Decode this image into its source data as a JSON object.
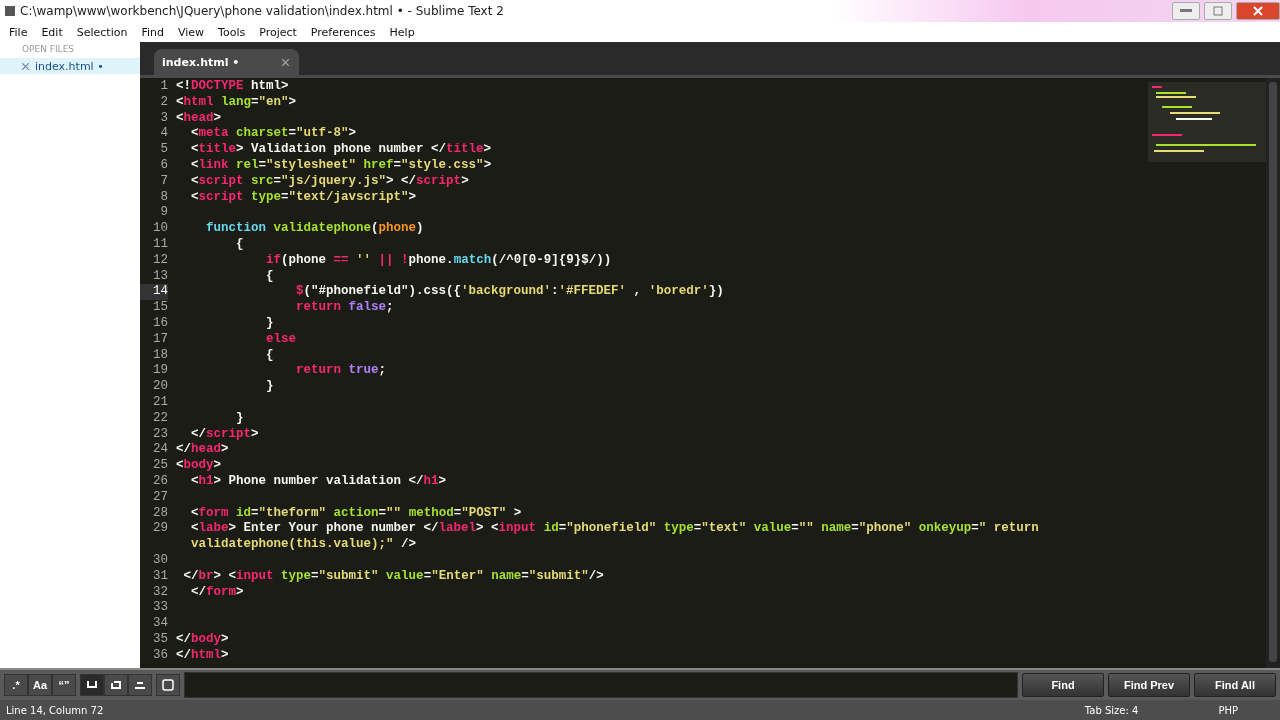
{
  "window": {
    "title": "C:\\wamp\\www\\workbench\\JQuery\\phone validation\\index.html • - Sublime Text 2"
  },
  "menu": [
    "File",
    "Edit",
    "Selection",
    "Find",
    "View",
    "Tools",
    "Project",
    "Preferences",
    "Help"
  ],
  "sidebar": {
    "header": "OPEN FILES",
    "files": [
      {
        "name": "index.html •",
        "selected": true
      }
    ]
  },
  "tabs": [
    {
      "label": "index.html •",
      "selected": true
    }
  ],
  "code": [
    {
      "number": "1",
      "current": false,
      "segments": [
        {
          "text": "<!",
          "kind": "plain"
        },
        {
          "text": "DOCTYPE",
          "kind": "tag"
        },
        {
          "text": " html>",
          "kind": "plain"
        }
      ]
    },
    {
      "number": "2",
      "current": false,
      "segments": [
        {
          "text": "<",
          "kind": "plain"
        },
        {
          "text": "html",
          "kind": "tag"
        },
        {
          "text": " lang",
          "kind": "attr"
        },
        {
          "text": "=",
          "kind": "plain"
        },
        {
          "text": "\"en\"",
          "kind": "str"
        },
        {
          "text": ">",
          "kind": "plain"
        }
      ]
    },
    {
      "number": "3",
      "current": false,
      "segments": [
        {
          "text": "<",
          "kind": "plain"
        },
        {
          "text": "head",
          "kind": "tag"
        },
        {
          "text": ">",
          "kind": "plain"
        }
      ]
    },
    {
      "number": "4",
      "current": false,
      "segments": [
        {
          "text": "  <",
          "kind": "plain"
        },
        {
          "text": "meta",
          "kind": "tag"
        },
        {
          "text": " charset",
          "kind": "attr"
        },
        {
          "text": "=",
          "kind": "plain"
        },
        {
          "text": "\"utf-8\"",
          "kind": "str"
        },
        {
          "text": ">",
          "kind": "plain"
        }
      ]
    },
    {
      "number": "5",
      "current": false,
      "segments": [
        {
          "text": "  <",
          "kind": "plain"
        },
        {
          "text": "title",
          "kind": "tag"
        },
        {
          "text": "> Validation phone number </",
          "kind": "plain"
        },
        {
          "text": "title",
          "kind": "tag"
        },
        {
          "text": ">",
          "kind": "plain"
        }
      ]
    },
    {
      "number": "6",
      "current": false,
      "segments": [
        {
          "text": "  <",
          "kind": "plain"
        },
        {
          "text": "link",
          "kind": "tag"
        },
        {
          "text": " rel",
          "kind": "attr"
        },
        {
          "text": "=",
          "kind": "plain"
        },
        {
          "text": "\"stylesheet\"",
          "kind": "str"
        },
        {
          "text": " href",
          "kind": "attr"
        },
        {
          "text": "=",
          "kind": "plain"
        },
        {
          "text": "\"style.css\"",
          "kind": "str"
        },
        {
          "text": ">",
          "kind": "plain"
        }
      ]
    },
    {
      "number": "7",
      "current": false,
      "segments": [
        {
          "text": "  <",
          "kind": "plain"
        },
        {
          "text": "script",
          "kind": "tag"
        },
        {
          "text": " src",
          "kind": "attr"
        },
        {
          "text": "=",
          "kind": "plain"
        },
        {
          "text": "\"js/jquery.js\"",
          "kind": "str"
        },
        {
          "text": "> </",
          "kind": "plain"
        },
        {
          "text": "script",
          "kind": "tag"
        },
        {
          "text": ">",
          "kind": "plain"
        }
      ]
    },
    {
      "number": "8",
      "current": false,
      "segments": [
        {
          "text": "  <",
          "kind": "plain"
        },
        {
          "text": "script",
          "kind": "tag"
        },
        {
          "text": " type",
          "kind": "attr"
        },
        {
          "text": "=",
          "kind": "plain"
        },
        {
          "text": "\"text/javscript\"",
          "kind": "str"
        },
        {
          "text": ">",
          "kind": "plain"
        }
      ]
    },
    {
      "number": "9",
      "current": false
    },
    {
      "number": "10",
      "current": false,
      "segments": [
        {
          "text": "    function",
          "kind": "fn"
        },
        {
          "text": " validatephone",
          "kind": "attr"
        },
        {
          "text": "(",
          "kind": "plain"
        },
        {
          "text": "phone",
          "kind": "param"
        },
        {
          "text": ")",
          "kind": "plain"
        }
      ]
    },
    {
      "number": "11",
      "current": false,
      "segments": [
        {
          "text": "        {",
          "kind": "plain"
        }
      ]
    },
    {
      "number": "12",
      "current": false,
      "segments": [
        {
          "text": "            if",
          "kind": "tag"
        },
        {
          "text": "(phone ",
          "kind": "plain"
        },
        {
          "text": "==",
          "kind": "tag"
        },
        {
          "text": " ''",
          "kind": "str"
        },
        {
          "text": " ||",
          "kind": "tag"
        },
        {
          "text": " !",
          "kind": "tag"
        },
        {
          "text": "phone.",
          "kind": "plain"
        },
        {
          "text": "match",
          "kind": "fn"
        },
        {
          "text": "(/^0[0-9]{9}$/))",
          "kind": "plain"
        }
      ]
    },
    {
      "number": "13",
      "current": false,
      "segments": [
        {
          "text": "            {",
          "kind": "plain"
        }
      ]
    },
    {
      "number": "14",
      "current": true,
      "segments": [
        {
          "text": "                $",
          "kind": "tag"
        },
        {
          "text": "(\"#phonefield\").css({",
          "kind": "plain"
        },
        {
          "text": "'background'",
          "kind": "str"
        },
        {
          "text": ":",
          "kind": "plain"
        },
        {
          "text": "'#FFEDEF'",
          "kind": "str"
        },
        {
          "text": " , ",
          "kind": "plain"
        },
        {
          "text": "'boredr'",
          "kind": "str"
        },
        {
          "text": "})",
          "kind": "plain"
        }
      ]
    },
    {
      "number": "15",
      "current": false,
      "segments": [
        {
          "text": "                return",
          "kind": "tag"
        },
        {
          "text": " false",
          "kind": "const"
        },
        {
          "text": ";",
          "kind": "plain"
        }
      ]
    },
    {
      "number": "16",
      "current": false,
      "segments": [
        {
          "text": "            }",
          "kind": "plain"
        }
      ]
    },
    {
      "number": "17",
      "current": false,
      "segments": [
        {
          "text": "            else",
          "kind": "tag"
        }
      ]
    },
    {
      "number": "18",
      "current": false,
      "segments": [
        {
          "text": "            {",
          "kind": "plain"
        }
      ]
    },
    {
      "number": "19",
      "current": false,
      "segments": [
        {
          "text": "                return",
          "kind": "tag"
        },
        {
          "text": " true",
          "kind": "const"
        },
        {
          "text": ";",
          "kind": "plain"
        }
      ]
    },
    {
      "number": "20",
      "current": false,
      "segments": [
        {
          "text": "            }",
          "kind": "plain"
        }
      ]
    },
    {
      "number": "21",
      "current": false
    },
    {
      "number": "22",
      "current": false,
      "segments": [
        {
          "text": "        }",
          "kind": "plain"
        }
      ]
    },
    {
      "number": "23",
      "current": false,
      "segments": [
        {
          "text": "  </",
          "kind": "plain"
        },
        {
          "text": "script",
          "kind": "tag"
        },
        {
          "text": ">",
          "kind": "plain"
        }
      ]
    },
    {
      "number": "24",
      "current": false,
      "segments": [
        {
          "text": "</",
          "kind": "plain"
        },
        {
          "text": "head",
          "kind": "tag"
        },
        {
          "text": ">",
          "kind": "plain"
        }
      ]
    },
    {
      "number": "25",
      "current": false,
      "segments": [
        {
          "text": "<",
          "kind": "plain"
        },
        {
          "text": "body",
          "kind": "tag"
        },
        {
          "text": ">",
          "kind": "plain"
        }
      ]
    },
    {
      "number": "26",
      "current": false,
      "segments": [
        {
          "text": "  <",
          "kind": "plain"
        },
        {
          "text": "h1",
          "kind": "tag"
        },
        {
          "text": "> Phone number validation </",
          "kind": "plain"
        },
        {
          "text": "h1",
          "kind": "tag"
        },
        {
          "text": ">",
          "kind": "plain"
        }
      ]
    },
    {
      "number": "27",
      "current": false
    },
    {
      "number": "28",
      "current": false,
      "segments": [
        {
          "text": "  <",
          "kind": "plain"
        },
        {
          "text": "form",
          "kind": "tag"
        },
        {
          "text": " id",
          "kind": "attr"
        },
        {
          "text": "=",
          "kind": "plain"
        },
        {
          "text": "\"theform\"",
          "kind": "str"
        },
        {
          "text": " action",
          "kind": "attr"
        },
        {
          "text": "=",
          "kind": "plain"
        },
        {
          "text": "\"\"",
          "kind": "str"
        },
        {
          "text": " method",
          "kind": "attr"
        },
        {
          "text": "=",
          "kind": "plain"
        },
        {
          "text": "\"POST\"",
          "kind": "str"
        },
        {
          "text": " >",
          "kind": "plain"
        }
      ]
    },
    {
      "number": "29",
      "current": false,
      "segments": [
        {
          "text": "  <",
          "kind": "plain"
        },
        {
          "text": "labe",
          "kind": "tag"
        },
        {
          "text": "> Enter Your phone number </",
          "kind": "plain"
        },
        {
          "text": "label",
          "kind": "tag"
        },
        {
          "text": "> <",
          "kind": "plain"
        },
        {
          "text": "input",
          "kind": "tag"
        },
        {
          "text": " id",
          "kind": "attr"
        },
        {
          "text": "=",
          "kind": "plain"
        },
        {
          "text": "\"phonefield\"",
          "kind": "str"
        },
        {
          "text": " type",
          "kind": "attr"
        },
        {
          "text": "=",
          "kind": "plain"
        },
        {
          "text": "\"text\"",
          "kind": "str"
        },
        {
          "text": " value",
          "kind": "attr"
        },
        {
          "text": "=",
          "kind": "plain"
        },
        {
          "text": "\"\"",
          "kind": "str"
        },
        {
          "text": " name",
          "kind": "attr"
        },
        {
          "text": "=",
          "kind": "plain"
        },
        {
          "text": "\"phone\"",
          "kind": "str"
        },
        {
          "text": " onkeyup",
          "kind": "attr"
        },
        {
          "text": "=",
          "kind": "plain"
        },
        {
          "text": "\" return",
          "kind": "str"
        }
      ],
      "wrapped": [
        {
          "text": "  validatephone(this.value);\"",
          "kind": "str"
        },
        {
          "text": " />",
          "kind": "plain"
        }
      ]
    },
    {
      "number": "30",
      "current": false
    },
    {
      "number": "31",
      "current": false,
      "segments": [
        {
          "text": " </",
          "kind": "plain"
        },
        {
          "text": "br",
          "kind": "tag"
        },
        {
          "text": "> <",
          "kind": "plain"
        },
        {
          "text": "input",
          "kind": "tag"
        },
        {
          "text": " type",
          "kind": "attr"
        },
        {
          "text": "=",
          "kind": "plain"
        },
        {
          "text": "\"submit\"",
          "kind": "str"
        },
        {
          "text": " value",
          "kind": "attr"
        },
        {
          "text": "=",
          "kind": "plain"
        },
        {
          "text": "\"Enter\"",
          "kind": "str"
        },
        {
          "text": " name",
          "kind": "attr"
        },
        {
          "text": "=",
          "kind": "plain"
        },
        {
          "text": "\"submit\"",
          "kind": "str"
        },
        {
          "text": "/>",
          "kind": "plain"
        }
      ]
    },
    {
      "number": "32",
      "current": false,
      "segments": [
        {
          "text": "  </",
          "kind": "plain"
        },
        {
          "text": "form",
          "kind": "tag"
        },
        {
          "text": ">",
          "kind": "plain"
        }
      ]
    },
    {
      "number": "33",
      "current": false
    },
    {
      "number": "34",
      "current": false
    },
    {
      "number": "35",
      "current": false,
      "segments": [
        {
          "text": "</",
          "kind": "plain"
        },
        {
          "text": "body",
          "kind": "tag"
        },
        {
          "text": ">",
          "kind": "plain"
        }
      ]
    },
    {
      "number": "36",
      "current": false,
      "segments": [
        {
          "text": "</",
          "kind": "plain"
        },
        {
          "text": "html",
          "kind": "tag"
        },
        {
          "text": ">",
          "kind": "plain"
        }
      ]
    }
  ],
  "find_panel": {
    "toggles": [
      ".*",
      "Aa",
      "“”"
    ],
    "buttons": [
      "Find",
      "Find Prev",
      "Find All"
    ]
  },
  "status_bar": {
    "position": "Line 14, Column 72",
    "tab_size": "Tab Size: 4",
    "syntax": "PHP"
  }
}
